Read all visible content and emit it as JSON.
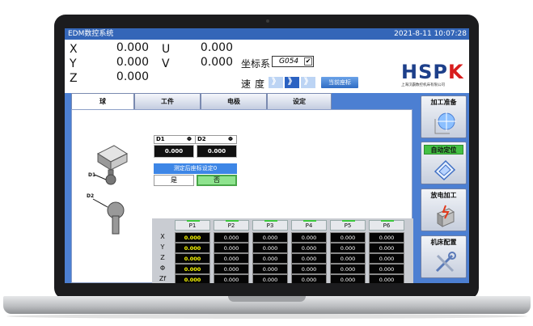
{
  "titlebar": {
    "title": "EDM数控系统",
    "datetime": "2021-8-11 10:07:28"
  },
  "axes": [
    {
      "name": "X",
      "value": "0.000"
    },
    {
      "name": "Y",
      "value": "0.000"
    },
    {
      "name": "Z",
      "value": "0.000"
    },
    {
      "name": "U",
      "value": "0.000"
    },
    {
      "name": "V",
      "value": "0.000"
    }
  ],
  "coord": {
    "label": "坐标系",
    "value": "G054"
  },
  "speed": {
    "label": "速度",
    "buttons": [
      "》",
      "》",
      "》"
    ],
    "current_button": "当前座标"
  },
  "logo": {
    "text_main": "HSP",
    "text_accent": "K",
    "subtitle": "上海汉霸数控机床有限公司"
  },
  "tabs": [
    "球",
    "工件",
    "电极",
    "设定"
  ],
  "measure": {
    "d1_label": "D1",
    "d2_label": "D2",
    "symbol": "Φ",
    "d1_value": "0.000",
    "d2_value": "0.000",
    "set_text": "测定后座标设定0",
    "yes": "是",
    "no": "否",
    "diagram_d1": "D1",
    "diagram_d2": "D2"
  },
  "table": {
    "columns": [
      "P1",
      "P2",
      "P3",
      "P4",
      "P5",
      "P6"
    ],
    "rows": [
      {
        "label": "X",
        "values": [
          "0.000",
          "0.000",
          "0.000",
          "0.000",
          "0.000",
          "0.000"
        ]
      },
      {
        "label": "Y",
        "values": [
          "0.000",
          "0.000",
          "0.000",
          "0.000",
          "0.000",
          "0.000"
        ]
      },
      {
        "label": "Z",
        "values": [
          "0.000",
          "0.000",
          "0.000",
          "0.000",
          "0.000",
          "0.000"
        ]
      },
      {
        "label": "Φ",
        "values": [
          "0.000",
          "0.000",
          "0.000",
          "0.000",
          "0.000",
          "0.000"
        ]
      },
      {
        "label": "Zf",
        "values": [
          "0.000",
          "0.000",
          "0.000",
          "0.000",
          "0.000",
          "0.000"
        ]
      }
    ]
  },
  "sidebar": [
    {
      "label": "加工准备",
      "icon": "target-icon"
    },
    {
      "label": "自动定位",
      "icon": "locate-icon"
    },
    {
      "label": "放电加工",
      "icon": "spark-icon"
    },
    {
      "label": "机床配置",
      "icon": "tools-icon"
    }
  ],
  "colors": {
    "title_bar": "#3466b8",
    "panel": "#4c7fd2",
    "active": "#44c144"
  }
}
